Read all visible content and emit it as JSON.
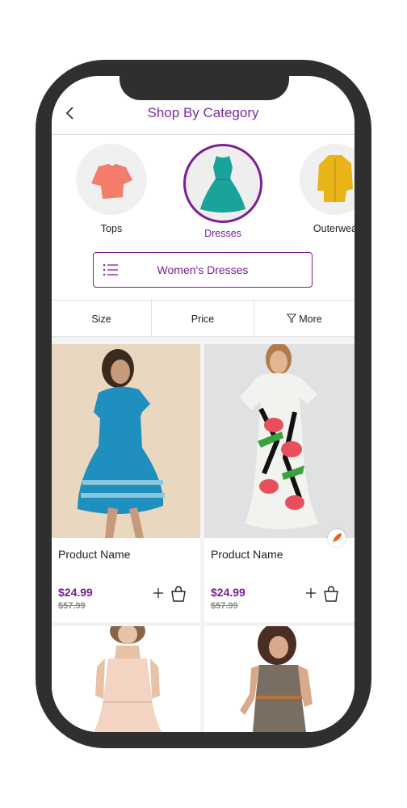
{
  "header": {
    "title": "Shop By Category"
  },
  "categories": [
    {
      "label": "Tops",
      "icon": "top-shirt-image"
    },
    {
      "label": "Dresses",
      "icon": "dress-image",
      "active": true
    },
    {
      "label": "Outerwea",
      "icon": "jacket-image"
    }
  ],
  "subcategory": {
    "label": "Women's Dresses",
    "icon": "list-icon"
  },
  "filters": [
    "Size",
    "Price",
    "More"
  ],
  "products": [
    {
      "name": "Product Name",
      "price": "$24.99",
      "old_price": "$57.99"
    },
    {
      "name": "Product Name",
      "price": "$24.99",
      "old_price": "$57.99",
      "badge": "rocket-icon"
    }
  ],
  "colors": {
    "accent": "#7d1e96",
    "phone_frame": "#2f2f2f",
    "badge": "#e8601c"
  }
}
